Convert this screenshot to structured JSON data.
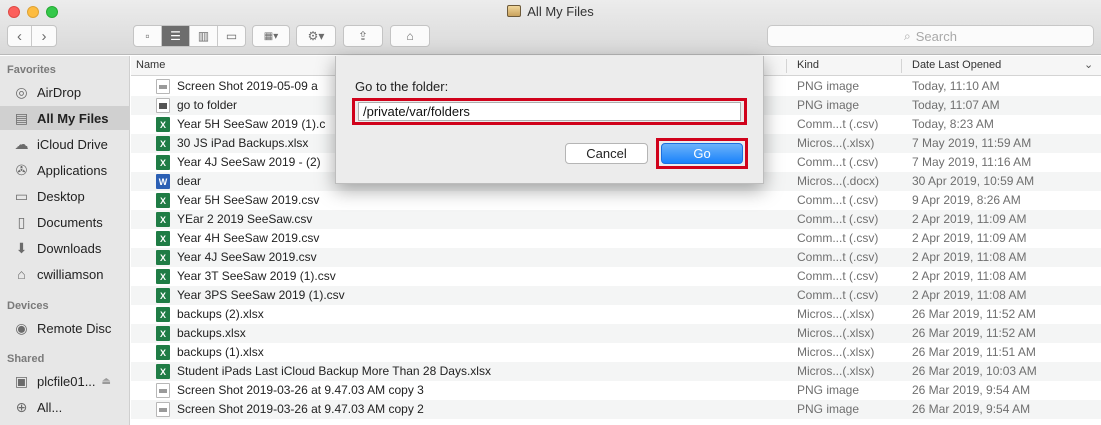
{
  "window": {
    "title": "All My Files"
  },
  "toolbar": {
    "back_icon": "chevron-left",
    "forward_icon": "chevron-right",
    "view_icons": [
      "icon-view",
      "list-view",
      "column-view",
      "cover-flow-view"
    ],
    "arrange_icon": "arrange",
    "action_icon": "gear",
    "share_icon": "share",
    "tag_icon": "tag",
    "search_placeholder": "Search"
  },
  "sidebar": {
    "sections": [
      {
        "title": "Favorites",
        "items": [
          {
            "label": "AirDrop",
            "icon": "airdrop-icon"
          },
          {
            "label": "All My Files",
            "icon": "all-my-files-icon",
            "selected": true
          },
          {
            "label": "iCloud Drive",
            "icon": "cloud-icon"
          },
          {
            "label": "Applications",
            "icon": "applications-icon"
          },
          {
            "label": "Desktop",
            "icon": "desktop-icon"
          },
          {
            "label": "Documents",
            "icon": "documents-icon"
          },
          {
            "label": "Downloads",
            "icon": "downloads-icon"
          },
          {
            "label": "cwilliamson",
            "icon": "home-icon"
          }
        ]
      },
      {
        "title": "Devices",
        "items": [
          {
            "label": "Remote Disc",
            "icon": "disc-icon"
          }
        ]
      },
      {
        "title": "Shared",
        "items": [
          {
            "label": "plcfile01...",
            "icon": "server-icon"
          },
          {
            "label": "All...",
            "icon": "network-icon"
          }
        ]
      }
    ]
  },
  "columns": {
    "name": "Name",
    "kind": "Kind",
    "date": "Date Last Opened"
  },
  "files": [
    {
      "name": "Screen Shot 2019-05-09 a",
      "kind": "PNG image",
      "date": "Today, 11:10 AM",
      "type": "png"
    },
    {
      "name": "go to folder",
      "kind": "PNG image",
      "date": "Today, 11:07 AM",
      "type": "png-dark"
    },
    {
      "name": "Year 5H SeeSaw 2019 (1).c",
      "kind": "Comm...t (.csv)",
      "date": "Today, 8:23 AM",
      "type": "xls"
    },
    {
      "name": "30 JS iPad Backups.xlsx",
      "kind": "Micros...(.xlsx)",
      "date": "7 May 2019, 11:59 AM",
      "type": "xls"
    },
    {
      "name": "Year 4J SeeSaw 2019 -  (2)",
      "kind": "Comm...t (.csv)",
      "date": "7 May 2019, 11:16 AM",
      "type": "xls"
    },
    {
      "name": "dear",
      "kind": "Micros...(.docx)",
      "date": "30 Apr 2019, 10:59 AM",
      "type": "doc"
    },
    {
      "name": "Year 5H SeeSaw 2019.csv",
      "kind": "Comm...t (.csv)",
      "date": "9 Apr 2019, 8:26 AM",
      "type": "xls"
    },
    {
      "name": "YEar 2 2019 SeeSaw.csv",
      "kind": "Comm...t (.csv)",
      "date": "2 Apr 2019, 11:09 AM",
      "type": "xls"
    },
    {
      "name": "Year 4H SeeSaw 2019.csv",
      "kind": "Comm...t (.csv)",
      "date": "2 Apr 2019, 11:09 AM",
      "type": "xls"
    },
    {
      "name": "Year 4J SeeSaw 2019.csv",
      "kind": "Comm...t (.csv)",
      "date": "2 Apr 2019, 11:08 AM",
      "type": "xls"
    },
    {
      "name": "Year 3T SeeSaw 2019 (1).csv",
      "kind": "Comm...t (.csv)",
      "date": "2 Apr 2019, 11:08 AM",
      "type": "xls"
    },
    {
      "name": "Year 3PS SeeSaw 2019 (1).csv",
      "kind": "Comm...t (.csv)",
      "date": "2 Apr 2019, 11:08 AM",
      "type": "xls"
    },
    {
      "name": "backups (2).xlsx",
      "kind": "Micros...(.xlsx)",
      "date": "26 Mar 2019, 11:52 AM",
      "type": "xls"
    },
    {
      "name": "backups.xlsx",
      "kind": "Micros...(.xlsx)",
      "date": "26 Mar 2019, 11:52 AM",
      "type": "xls"
    },
    {
      "name": "backups (1).xlsx",
      "kind": "Micros...(.xlsx)",
      "date": "26 Mar 2019, 11:51 AM",
      "type": "xls"
    },
    {
      "name": "Student iPads Last iCloud Backup More Than 28 Days.xlsx",
      "kind": "Micros...(.xlsx)",
      "date": "26 Mar 2019, 10:03 AM",
      "type": "xls"
    },
    {
      "name": "Screen Shot 2019-03-26 at 9.47.03 AM copy 3",
      "kind": "PNG image",
      "date": "26 Mar 2019, 9:54 AM",
      "type": "png"
    },
    {
      "name": "Screen Shot 2019-03-26 at 9.47.03 AM copy 2",
      "kind": "PNG image",
      "date": "26 Mar 2019, 9:54 AM",
      "type": "png"
    }
  ],
  "dialog": {
    "label": "Go to the folder:",
    "path_value": "/private/var/folders",
    "cancel_label": "Cancel",
    "go_label": "Go",
    "highlight_color": "#d0021b"
  },
  "colors": {
    "go_button": "#1a82fb",
    "sidebar_bg": "#e7e7e7"
  }
}
